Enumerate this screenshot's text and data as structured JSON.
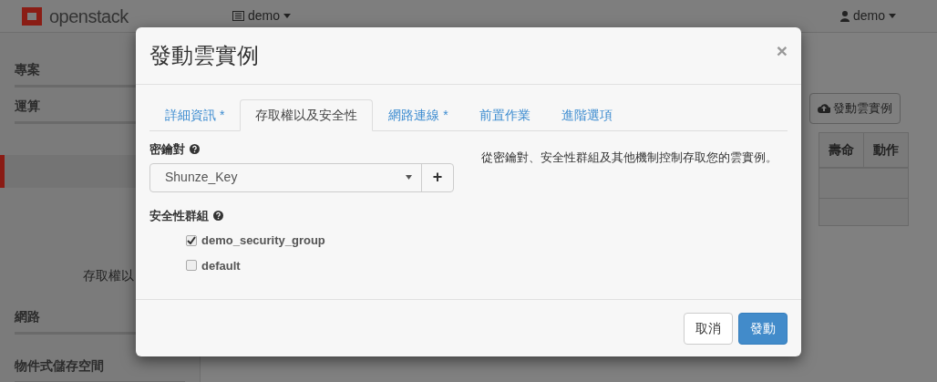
{
  "navbar": {
    "logo": "openstack",
    "project_menu": "demo",
    "user_menu": "demo"
  },
  "sidebar": {
    "sections": [
      {
        "label": "專案"
      },
      {
        "label": "運算"
      }
    ],
    "lower_sections": [
      {
        "label": "網路"
      },
      {
        "label": "物件式儲存空間"
      }
    ]
  },
  "page_text": "存取權以",
  "toolbar": {
    "launch_button": "發動雲實例"
  },
  "table": {
    "columns": [
      "壽命",
      "動作"
    ]
  },
  "modal": {
    "title": "發動雲實例",
    "close": "×",
    "tabs": [
      {
        "label": "詳細資訊 *",
        "selected": false
      },
      {
        "label": "存取權以及安全性",
        "selected": true
      },
      {
        "label": "網路連線 *",
        "selected": false
      },
      {
        "label": "前置作業",
        "selected": false
      },
      {
        "label": "進階選項",
        "selected": false
      }
    ],
    "keypair": {
      "label": "密鑰對",
      "value": "Shunze_Key",
      "add_button": "+"
    },
    "security_groups": {
      "label": "安全性群組",
      "items": [
        {
          "label": "demo_security_group",
          "checked": true
        },
        {
          "label": "default",
          "checked": false
        }
      ]
    },
    "help_text": "從密鑰對、安全性群組及其他機制控制存取您的雲實例。",
    "buttons": [
      {
        "label": "取消",
        "kind": "secondary"
      },
      {
        "label": "發動",
        "kind": "primary"
      }
    ]
  }
}
